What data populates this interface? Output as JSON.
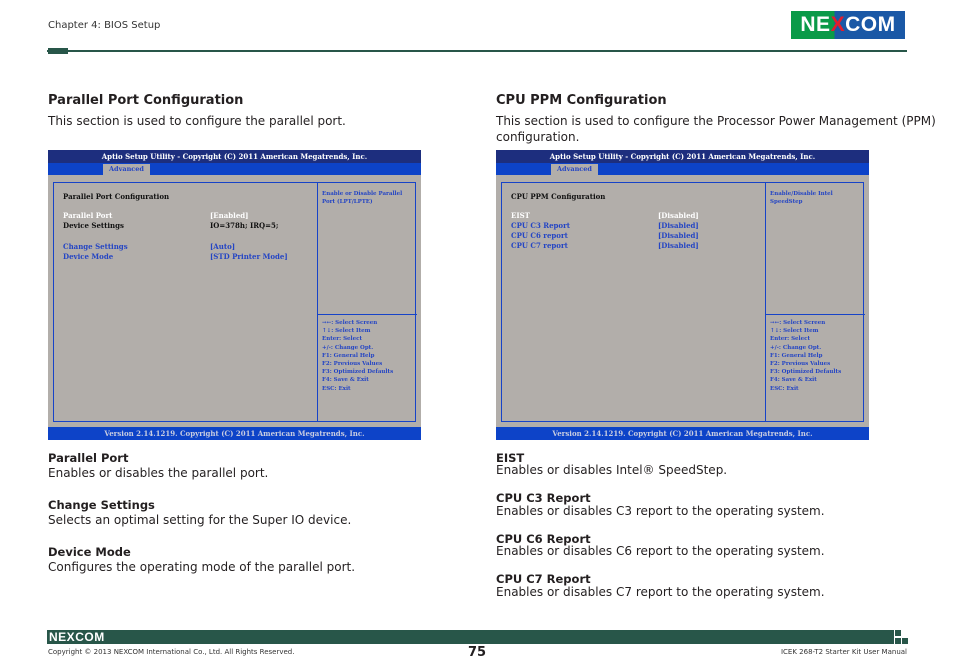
{
  "header": {
    "chapter": "Chapter 4: BIOS Setup",
    "logo": {
      "pre": "NE",
      "x": "X",
      "post": "COM"
    }
  },
  "colors": {
    "brand_green": "#285649",
    "bios_title_bg": "#1d2e7e",
    "bios_accent": "#0d43c8",
    "bios_bg": "#b2aeaa",
    "bios_text_blue": "#2445c4"
  },
  "left": {
    "title": "Parallel Port Configuration",
    "desc": "This section is used to configure the parallel port.",
    "bios": {
      "titlebar": "Aptio Setup Utility - Copyright (C) 2011 American Megatrends, Inc.",
      "tab": "Advanced",
      "panel_title": "Parallel Port Configuration",
      "rows": [
        {
          "label": "Parallel Port",
          "value": "[Enabled]",
          "state": "selected"
        },
        {
          "label": "Device Settings",
          "value": "IO=378h; IRQ=5;",
          "state": "readonly"
        },
        {
          "label": "Change Settings",
          "value": "[Auto]",
          "state": "option"
        },
        {
          "label": "Device Mode",
          "value": "[STD Printer Mode]",
          "state": "option"
        }
      ],
      "help": "Enable or Disable Parallel Port (LPT/LPTE)",
      "keys": [
        "→←: Select Screen",
        "↑↓: Select Item",
        "Enter: Select",
        "+/-: Change Opt.",
        "F1: General Help",
        "F2: Previous Values",
        "F3: Optimized Defaults",
        "F4: Save & Exit",
        "ESC: Exit"
      ],
      "footer": "Version 2.14.1219. Copyright (C) 2011 American Megatrends, Inc."
    },
    "items": [
      {
        "title": "Parallel Port",
        "desc": "Enables or disables the parallel port."
      },
      {
        "title": "Change Settings",
        "desc": "Selects an optimal setting for the Super IO device."
      },
      {
        "title": "Device Mode",
        "desc": "Configures the operating mode of the parallel port."
      }
    ]
  },
  "right": {
    "title": "CPU PPM Configuration",
    "desc_line1": "This section is used to configure the Processor Power Management (PPM)",
    "desc_line2": "configuration.",
    "bios": {
      "titlebar": "Aptio Setup Utility - Copyright (C) 2011 American Megatrends, Inc.",
      "tab": "Advanced",
      "panel_title": "CPU PPM Configuration",
      "rows": [
        {
          "label": "EIST",
          "value": "[Disabled]",
          "state": "selected"
        },
        {
          "label": "CPU C3 Report",
          "value": "[Disabled]",
          "state": "option"
        },
        {
          "label": "CPU C6 report",
          "value": "[Disabled]",
          "state": "option"
        },
        {
          "label": "CPU C7 report",
          "value": "[Disabled]",
          "state": "option"
        }
      ],
      "help": "Enable/Disable Intel SpeedStep",
      "keys": [
        "→←: Select Screen",
        "↑↓: Select Item",
        "Enter: Select",
        "+/-: Change Opt.",
        "F1: General Help",
        "F2: Previous Values",
        "F3: Optimized Defaults",
        "F4: Save & Exit",
        "ESC: Exit"
      ],
      "footer": "Version 2.14.1219. Copyright (C) 2011 American Megatrends, Inc."
    },
    "items": [
      {
        "title": "EIST",
        "desc": "Enables or disables Intel® SpeedStep."
      },
      {
        "title": "CPU C3 Report",
        "desc": "Enables or disables C3 report to the operating system."
      },
      {
        "title": "CPU C6 Report",
        "desc": "Enables or disables C6 report to the operating system."
      },
      {
        "title": "CPU C7 Report",
        "desc": "Enables or disables C7 report to the operating system."
      }
    ]
  },
  "footer": {
    "logo": {
      "pre": "NE",
      "x": "X",
      "post": "COM"
    },
    "copyright": "Copyright © 2013 NEXCOM International Co., Ltd. All Rights Reserved.",
    "page_number": "75",
    "manual": "ICEK 268-T2 Starter Kit User Manual"
  }
}
